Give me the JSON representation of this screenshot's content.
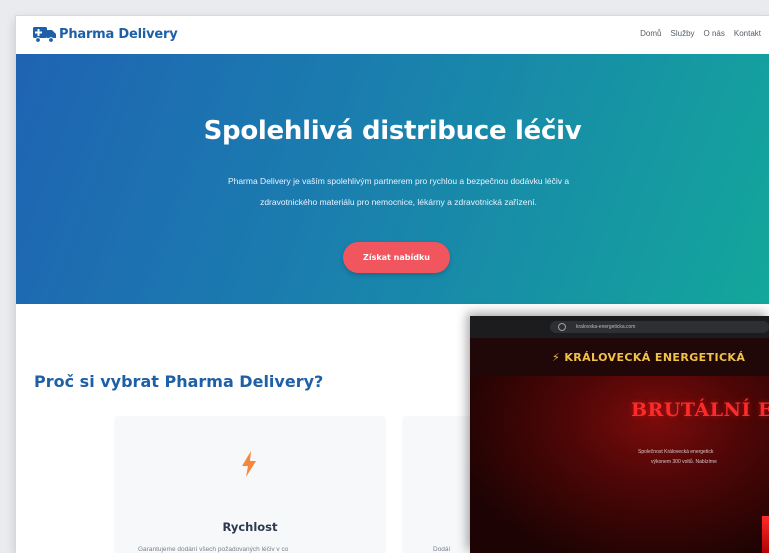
{
  "main_site": {
    "brand": "Pharma Delivery",
    "nav": [
      "Domů",
      "Služby",
      "O nás",
      "Kontakt"
    ],
    "hero": {
      "title": "Spolehlivá distribuce léčiv",
      "line1": "Pharma Delivery je vaším spolehlivým partnerem pro rychlou a bezpečnou dodávku léčiv a",
      "line2": "zdravotnického materiálu pro nemocnice, lékárny a zdravotnická zařízení.",
      "cta": "Získat nabídku"
    },
    "section_title": "Proč si vybrat Pharma Delivery?",
    "cards": [
      {
        "icon": "bolt-icon",
        "title": "Rychlost",
        "desc": "Garantujeme dodání všech požadovaných léčiv v co"
      },
      {
        "icon": "",
        "title": "",
        "desc": "Dodáí"
      }
    ]
  },
  "overlay_site": {
    "url": "kralovska-energeticka.com",
    "header": "⚡ KRÁLOVECKÁ ENERGETICKÁ",
    "headline": "BRUTÁLNÍ EN",
    "line1": "Společnost Královecká energetick",
    "line2": "výkonem 300 voltů. Nabízíme"
  },
  "colors": {
    "accent": "#1f5fa6",
    "cta": "#f1555e",
    "overlay_title": "#f0c24a",
    "overlay_headline": "#ff2b2b"
  }
}
